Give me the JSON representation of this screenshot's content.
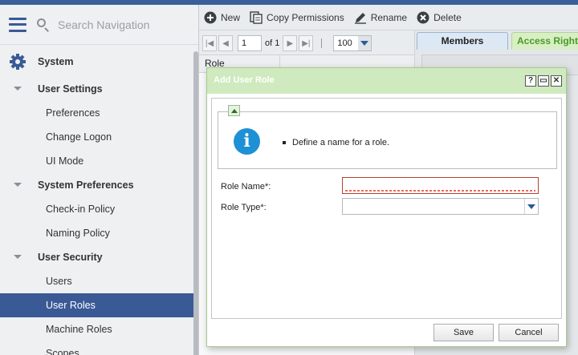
{
  "sidebar": {
    "search_placeholder": "Search Navigation",
    "section": "System",
    "groups": [
      {
        "label": "User Settings",
        "items": [
          "Preferences",
          "Change Logon",
          "UI Mode"
        ]
      },
      {
        "label": "System Preferences",
        "items": [
          "Check-in Policy",
          "Naming Policy"
        ]
      },
      {
        "label": "User Security",
        "items": [
          "Users",
          "User Roles",
          "Machine Roles",
          "Scopes"
        ]
      }
    ],
    "selected": "User Roles"
  },
  "toolbar": {
    "new_label": "New",
    "copy_label": "Copy Permissions",
    "rename_label": "Rename",
    "delete_label": "Delete"
  },
  "pager": {
    "page": "1",
    "of_label": "of 1",
    "page_size": "100"
  },
  "grid": {
    "column_header": "Role"
  },
  "right_panel": {
    "tabs": [
      "Members",
      "Access Right"
    ]
  },
  "dialog": {
    "title": "Add User Role",
    "help_label": "?",
    "info_message": "Define a name for a role.",
    "role_name_label": "Role Name*:",
    "role_name_value": "",
    "role_type_label": "Role Type*:",
    "role_type_value": "",
    "save_label": "Save",
    "cancel_label": "Cancel"
  },
  "colors": {
    "brand": "#3a5a96",
    "dialog_title": "#cfeabe",
    "error_border": "#b9412f",
    "info_icon": "#1e90d6"
  }
}
